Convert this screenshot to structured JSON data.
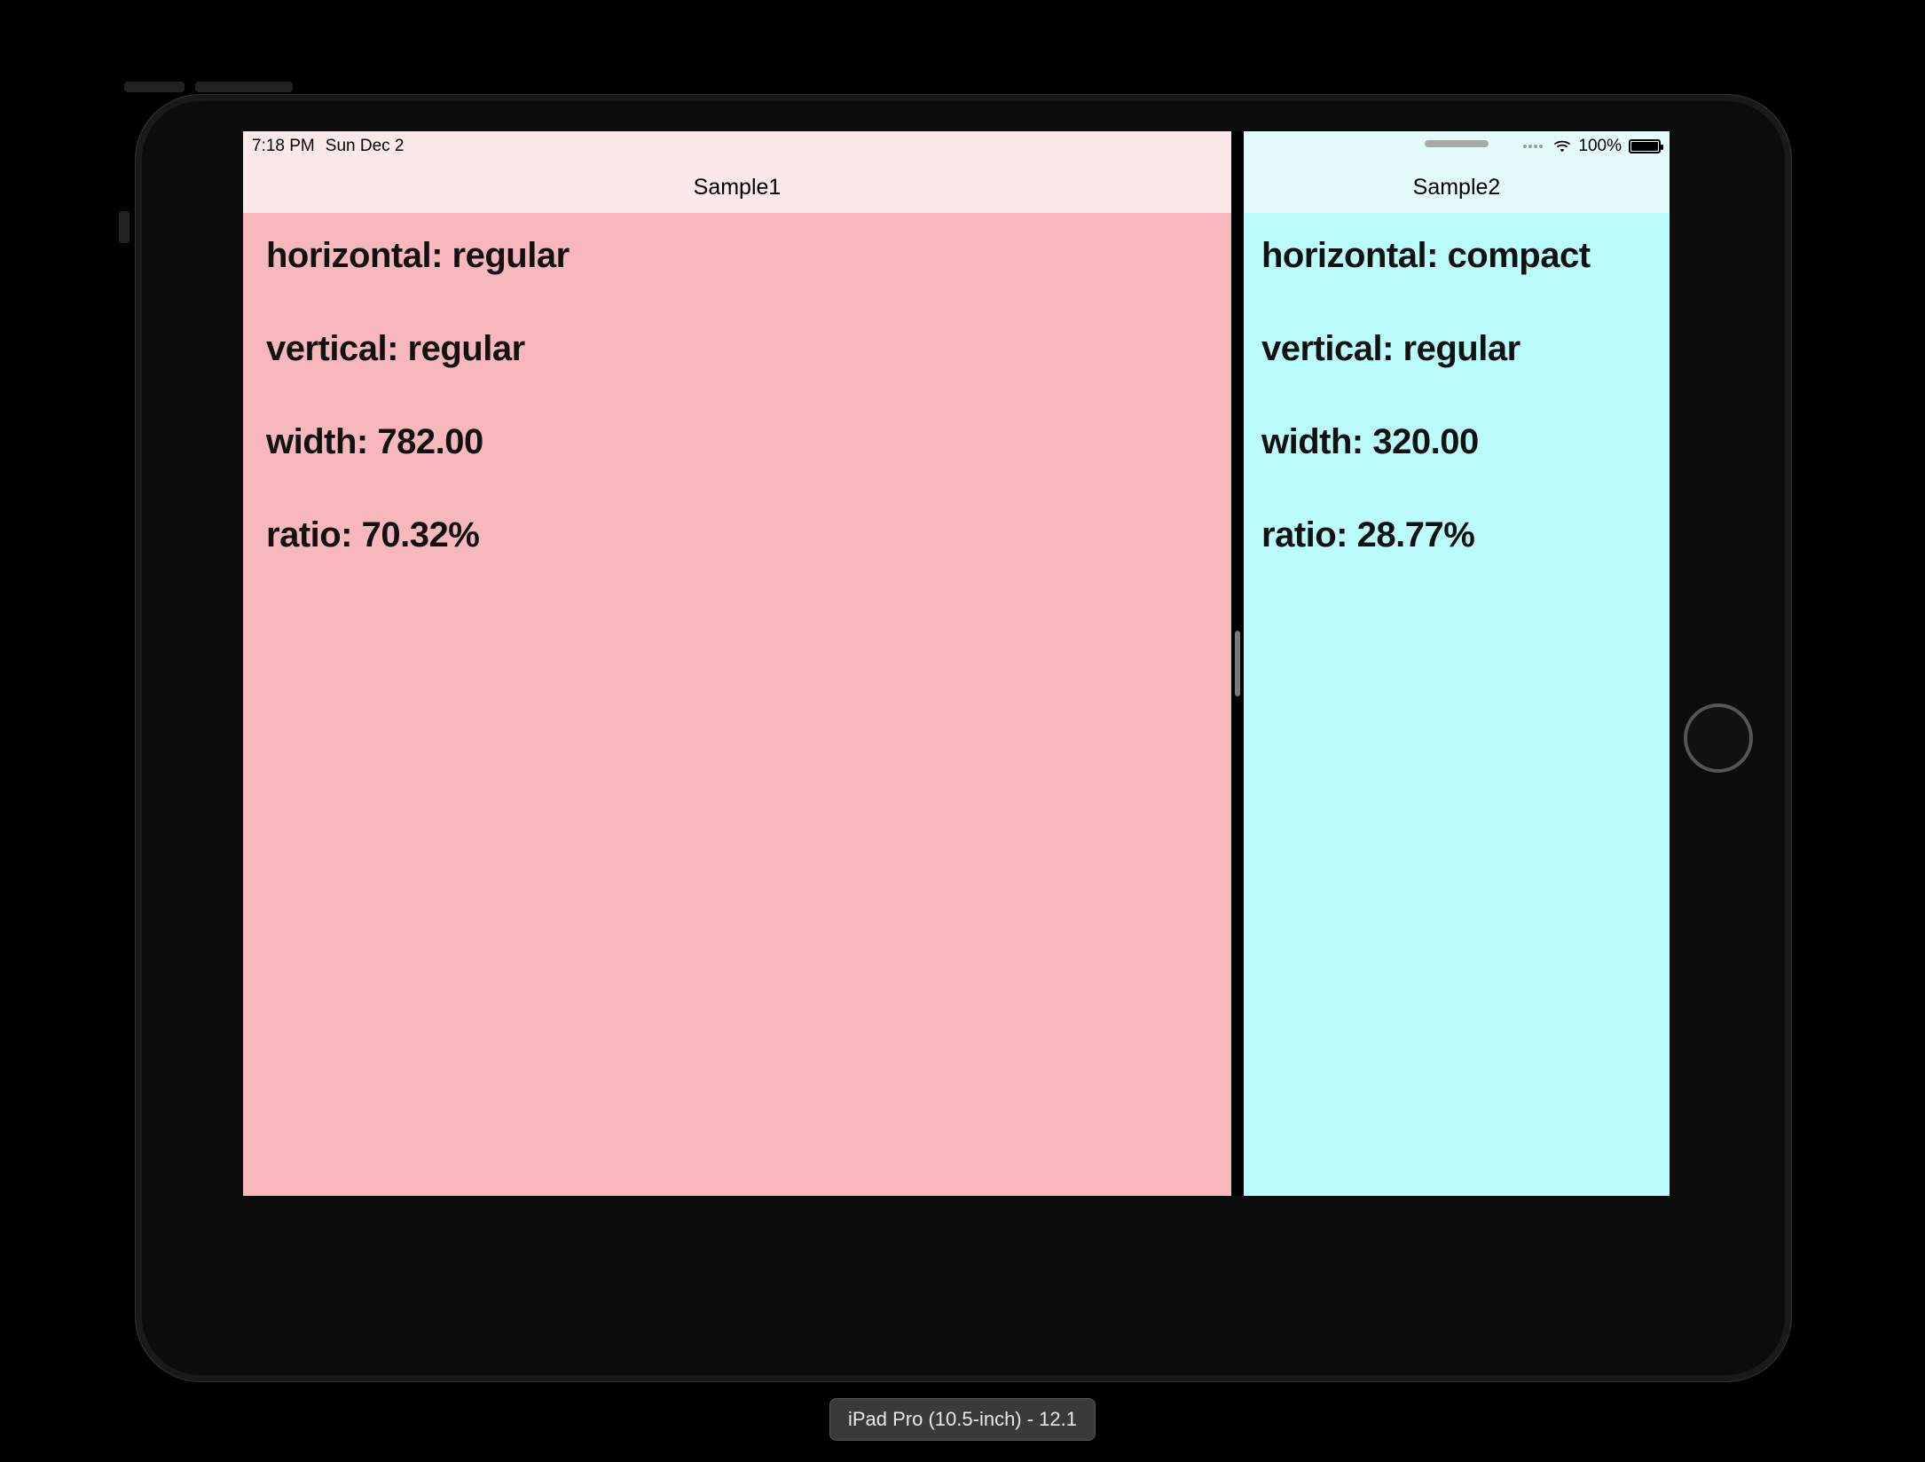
{
  "status_bar": {
    "time": "7:18 PM",
    "date": "Sun Dec 2",
    "battery_pct": "100%"
  },
  "panes": {
    "left": {
      "title": "Sample1",
      "horizontal": "horizontal: regular",
      "vertical": "vertical: regular",
      "width": "width: 782.00",
      "ratio": "ratio: 70.32%"
    },
    "right": {
      "title": "Sample2",
      "horizontal": "horizontal: compact",
      "vertical": "vertical: regular",
      "width": "width: 320.00",
      "ratio": "ratio: 28.77%"
    }
  },
  "simulator_caption": "iPad Pro (10.5-inch) - 12.1"
}
